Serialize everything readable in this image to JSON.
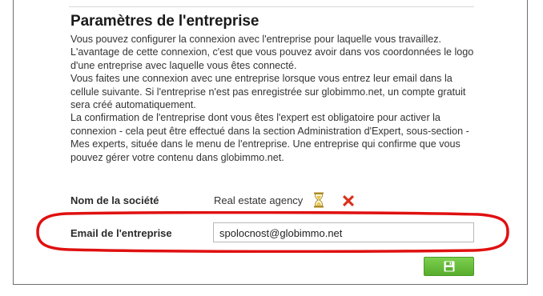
{
  "section": {
    "title": "Paramètres de l'entreprise",
    "paragraphs": [
      "Vous pouvez configurer la connexion avec l'entreprise pour laquelle vous travaillez. L'avantage de cette connexion, c'est que vous pouvez avoir dans vos coordonnées le logo d'une entreprise avec laquelle vous êtes connecté.",
      "Vous faites une connexion avec une entreprise lorsque vous entrez leur email dans la cellule suivante. Si l'entreprise n'est pas enregistrée sur globimmo.net, un compte gratuit sera créé automatiquement.",
      "La confirmation de l'entreprise dont vous êtes l'expert est obligatoire pour activer la connexion - cela peut être effectué dans la section Administration d'Expert, sous-section - Mes experts, située dans le menu de l'entreprise. Une entreprise qui confirme que vous pouvez gérer votre contenu dans globimmo.net."
    ]
  },
  "company": {
    "label": "Nom de la société",
    "value": "Real estate agency",
    "status_icon": "hourglass-icon",
    "remove_icon": "close-x-icon"
  },
  "email": {
    "label": "Email de l'entreprise",
    "value": "spolocnost@globimmo.net"
  },
  "save_button": {
    "icon": "floppy-disk-icon"
  },
  "colors": {
    "highlight": "#e01010",
    "remove": "#d9301c",
    "save_button": "#6cc03f",
    "hourglass": "#c9a830"
  }
}
